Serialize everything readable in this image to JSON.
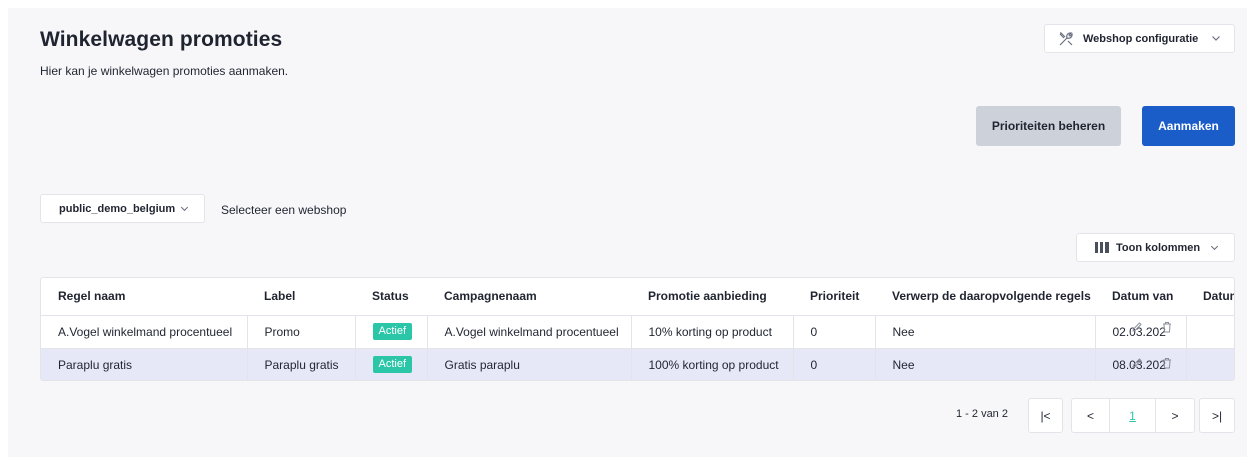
{
  "header": {
    "title": "Winkelwagen promoties",
    "subtitle": "Hier kan je winkelwagen promoties aanmaken.",
    "webshop_config_label": "Webshop configuratie"
  },
  "actions": {
    "priorities_label": "Prioriteiten beheren",
    "create_label": "Aanmaken"
  },
  "webshop_selector": {
    "selected": "public_demo_belgium",
    "hint": "Selecteer een webshop"
  },
  "columns_toggle_label": "Toon kolommen",
  "table": {
    "headers": [
      "Regel naam",
      "Label",
      "Status",
      "Campagnenaam",
      "Promotie aanbieding",
      "Prioriteit",
      "Verwerp de daaropvolgende regels",
      "Datum van",
      "Datum"
    ],
    "rows": [
      {
        "name": "A.Vogel winkelmand procentueel",
        "label": "Promo",
        "status": "Actief",
        "campaign": "A.Vogel winkelmand procentueel",
        "offer": "10% korting op product",
        "priority": "0",
        "discard_following": "Nee",
        "date_from": "02.03.202",
        "date_to": ""
      },
      {
        "name": "Paraplu gratis",
        "label": "Paraplu gratis",
        "status": "Actief",
        "campaign": "Gratis paraplu",
        "offer": "100% korting op product",
        "priority": "0",
        "discard_following": "Nee",
        "date_from": "08.03.202",
        "date_to": ""
      }
    ]
  },
  "pagination": {
    "info": "1 - 2 van 2",
    "current_page": "1",
    "first": "|<",
    "prev": "<",
    "next": ">",
    "last": ">|"
  },
  "colors": {
    "primary": "#1a5cc8",
    "secondary_button": "#cdd1d9",
    "status_active": "#2bc6a8",
    "selected_row": "#e6e8f7",
    "background": "#f7f7f9"
  }
}
